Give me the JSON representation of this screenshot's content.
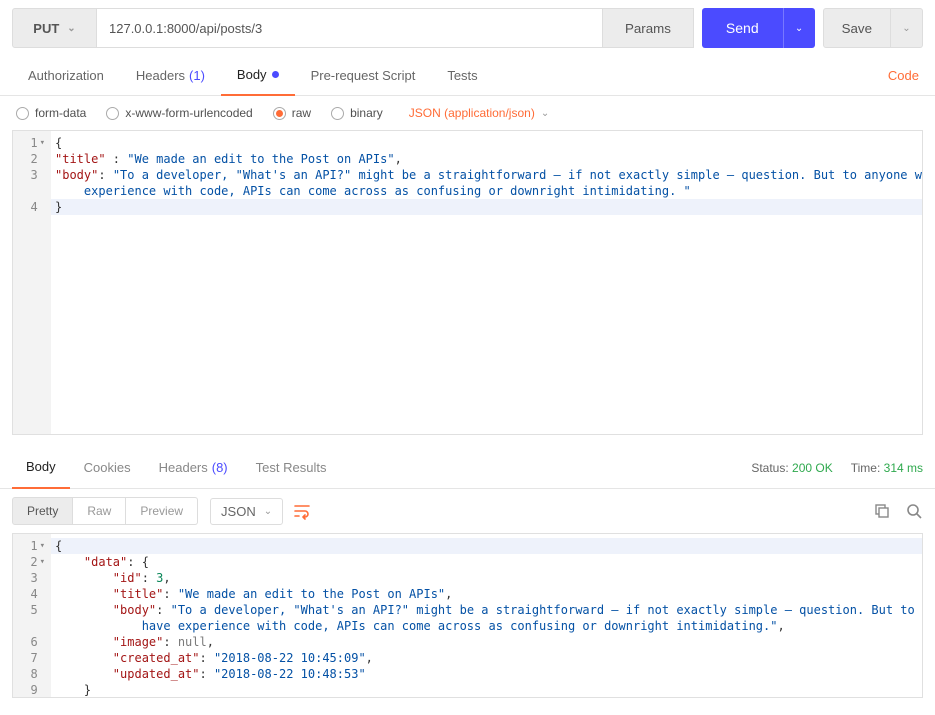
{
  "request": {
    "method": "PUT",
    "url": "127.0.0.1:8000/api/posts/3",
    "params_label": "Params",
    "send_label": "Send",
    "save_label": "Save"
  },
  "req_tabs": {
    "authorization": "Authorization",
    "headers": "Headers",
    "headers_count": "(1)",
    "body": "Body",
    "pre_request": "Pre-request Script",
    "tests": "Tests",
    "code": "Code"
  },
  "body_type": {
    "form_data": "form-data",
    "urlencoded": "x-www-form-urlencoded",
    "raw": "raw",
    "binary": "binary",
    "content_type": "JSON (application/json)"
  },
  "request_body": {
    "title_key": "\"title\"",
    "title_val": "\"We made an edit to the Post on APIs\"",
    "body_key": "\"body\"",
    "body_val1": "\"To a developer, \"What's an API?\" might be a straightforward – if not exactly simple – question. But to anyone who doesn't have ",
    "body_val2": "experience with code, APIs can come across as confusing or downright intimidating. \""
  },
  "resp_tabs": {
    "body": "Body",
    "cookies": "Cookies",
    "headers": "Headers",
    "headers_count": "(8)",
    "test_results": "Test Results"
  },
  "status": {
    "status_label": "Status:",
    "status_value": "200 OK",
    "time_label": "Time:",
    "time_value": "314 ms"
  },
  "view_modes": {
    "pretty": "Pretty",
    "raw": "Raw",
    "preview": "Preview",
    "format": "JSON"
  },
  "response_body": {
    "data_key": "\"data\"",
    "id_key": "\"id\"",
    "id_val": "3",
    "title_key": "\"title\"",
    "title_val": "\"We made an edit to the Post on APIs\"",
    "body_key": "\"body\"",
    "body_val1": "\"To a developer, \"What's an API?\" might be a straightforward – if not exactly simple – question. But to anyone who doesn't ",
    "body_val2": "have experience with code, APIs can come across as confusing or downright intimidating.\"",
    "image_key": "\"image\"",
    "image_val": "null",
    "created_key": "\"created_at\"",
    "created_val": "\"2018-08-22 10:45:09\"",
    "updated_key": "\"updated_at\"",
    "updated_val": "\"2018-08-22 10:48:53\""
  }
}
